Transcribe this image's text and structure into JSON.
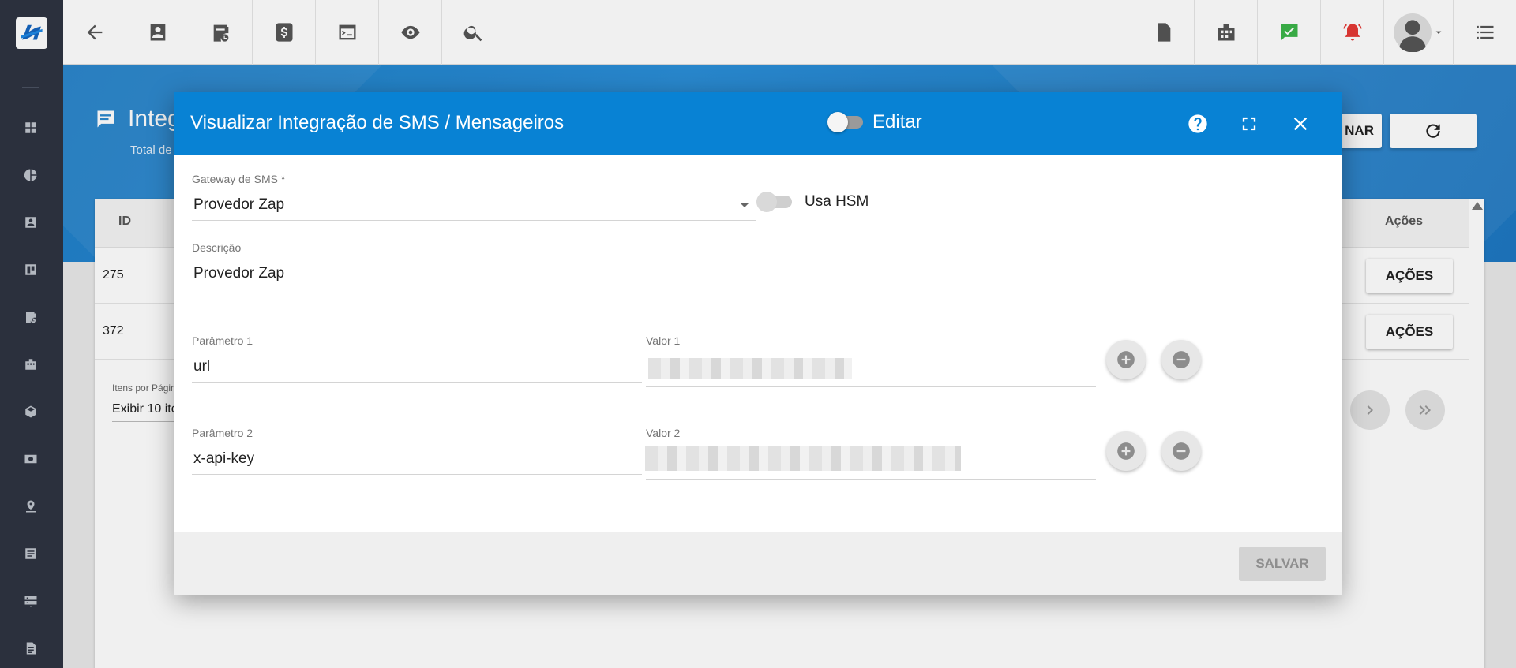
{
  "topbar": {
    "left_icons": [
      "arrow-back-icon",
      "contact-icon",
      "calendar-clock-icon",
      "dollar-icon",
      "terminal-icon",
      "eye-icon",
      "search-icon"
    ],
    "right_icons": [
      "pdf-icon",
      "building-icon",
      "check-chat-icon",
      "alarm-icon",
      "user-avatar",
      "list-icon"
    ]
  },
  "sidebar": {
    "icons": [
      "dashboard-icon",
      "pie-chart-icon",
      "contact-icon",
      "board-icon",
      "calendar-clock-icon",
      "building-icon",
      "package-icon",
      "money-icon",
      "location-icon",
      "list-icon",
      "server-icon",
      "document-icon"
    ]
  },
  "page": {
    "title": "Integ",
    "subtitle": "Total de",
    "hero_button_partial": "NAR"
  },
  "table": {
    "columns": {
      "id": "ID",
      "actions": "Ações"
    },
    "rows": [
      {
        "id": "275",
        "action": "AÇÕES"
      },
      {
        "id": "372",
        "action": "AÇÕES"
      }
    ],
    "pager": {
      "label": "Itens por Págin",
      "value": "Exibir 10 ite"
    }
  },
  "modal": {
    "title": "Visualizar Integração de SMS / Mensageiros",
    "edit_label": "Editar",
    "gateway": {
      "label": "Gateway de SMS *",
      "value": "Provedor Zap"
    },
    "hsm_label": "Usa HSM",
    "description": {
      "label": "Descrição",
      "value": "Provedor Zap"
    },
    "params": [
      {
        "param_label": "Parâmetro 1",
        "param_value": "url",
        "value_label": "Valor 1"
      },
      {
        "param_label": "Parâmetro 2",
        "param_value": "x-api-key",
        "value_label": "Valor 2"
      }
    ],
    "save_label": "SALVAR"
  },
  "colors": {
    "header_blue": "#0882d4",
    "sidebar_dark": "#2e3441",
    "hero_blue": "#2b8fd8",
    "chat_green": "#3cb54a",
    "alarm_red": "#e53935"
  }
}
